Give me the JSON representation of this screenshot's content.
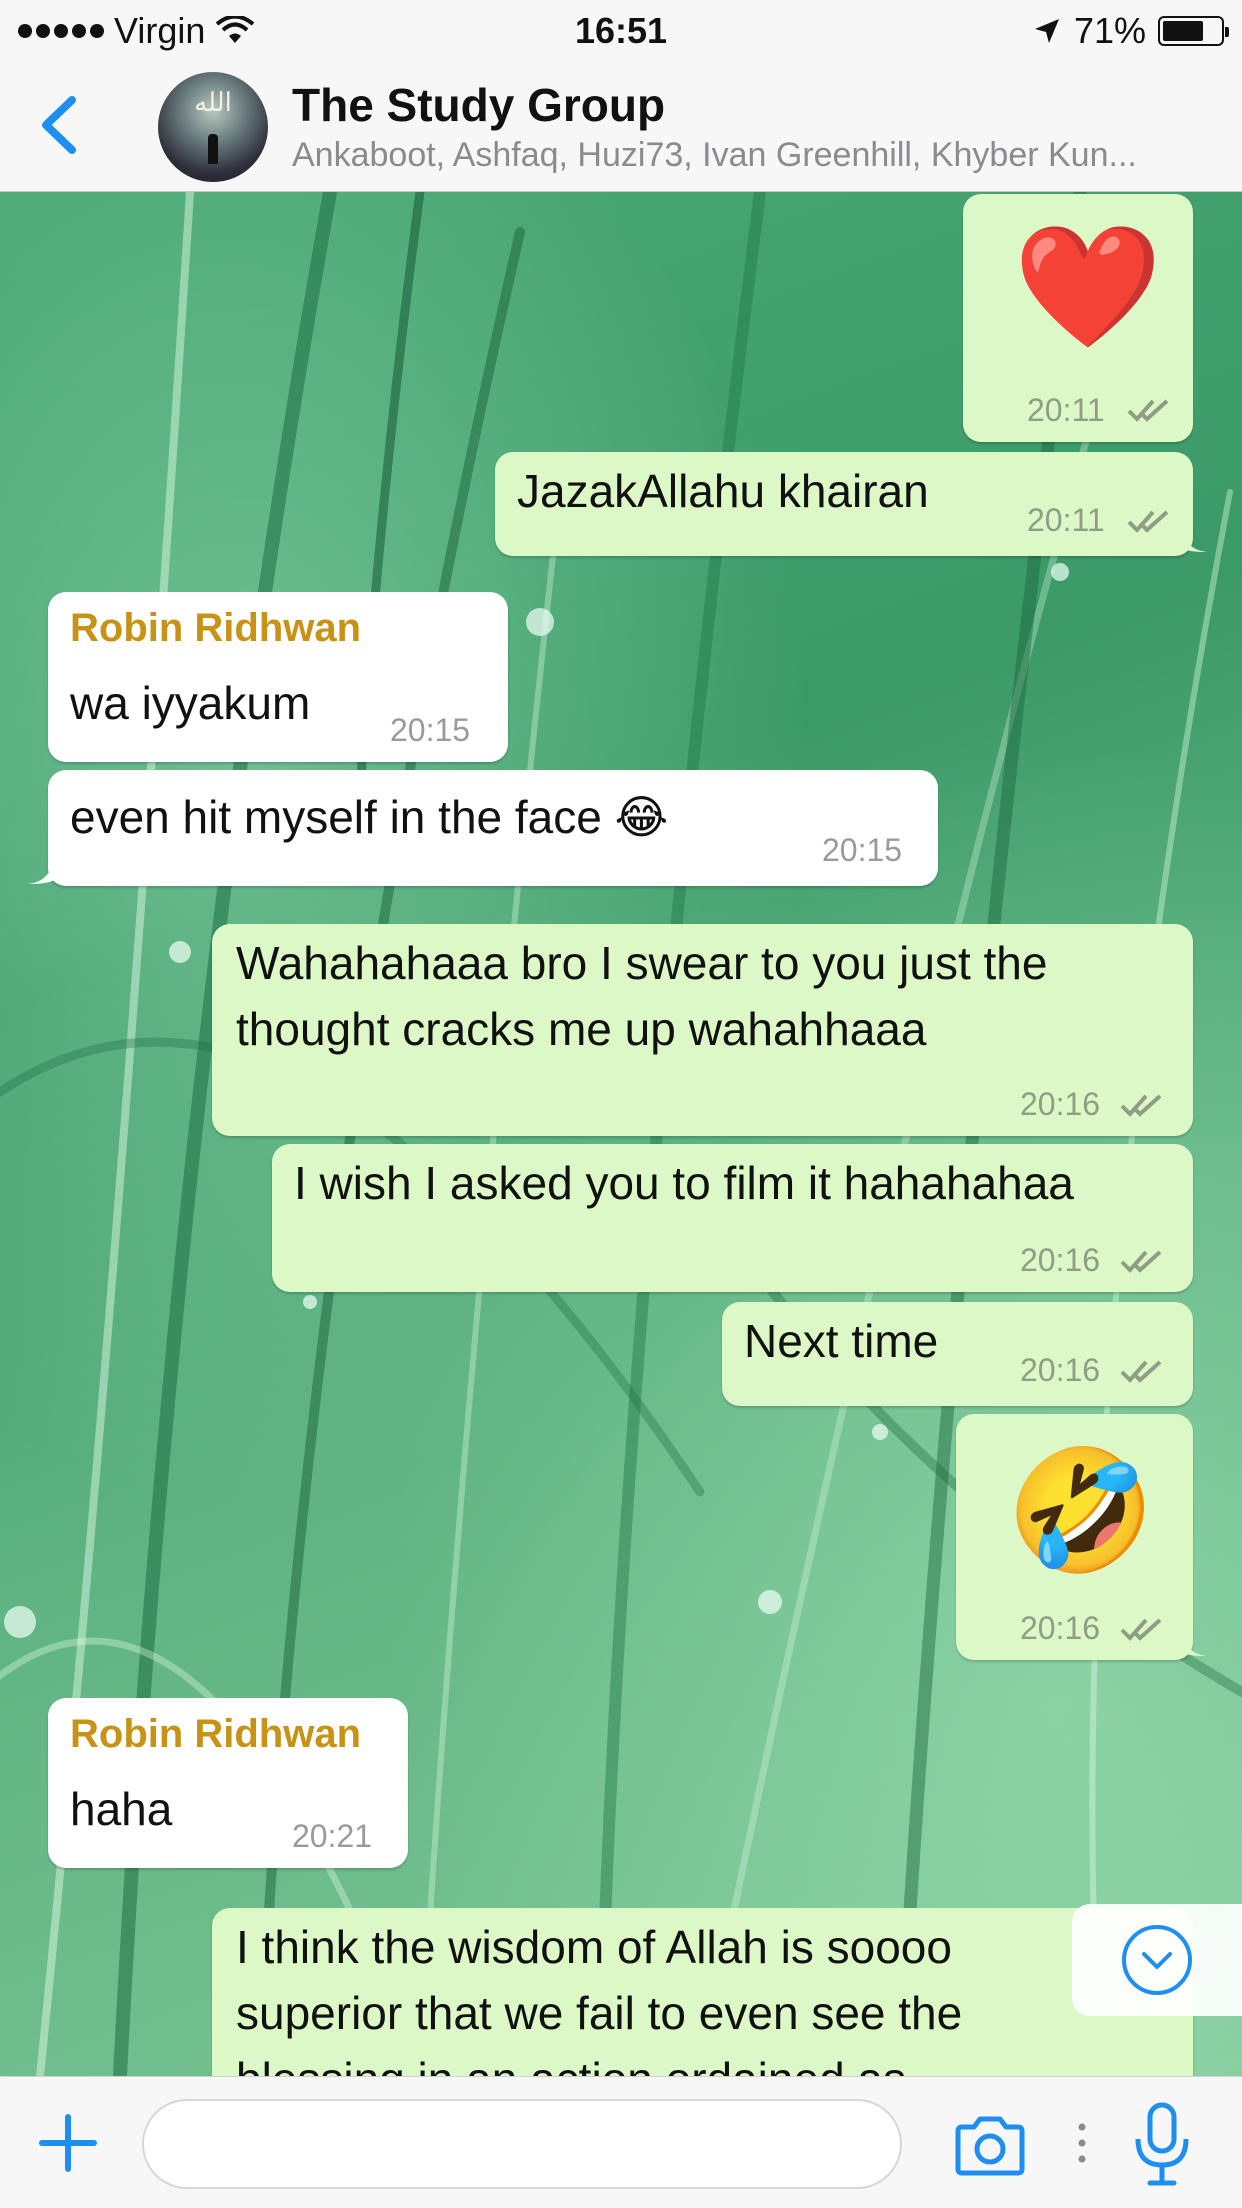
{
  "status_bar": {
    "carrier": "Virgin",
    "time": "16:51",
    "battery": "71%",
    "battery_level": 0.71
  },
  "header": {
    "title": "The Study Group",
    "subtitle": "Ankaboot, Ashfaq, Huzi73, Ivan Greenhill, Khyber Kun...",
    "back_icon": "chevron-left-icon",
    "avatar_glyph": "الله"
  },
  "messages": [
    {
      "id": "m1",
      "direction": "out",
      "emoji": "❤️",
      "time": "20:11",
      "status": "read"
    },
    {
      "id": "m2",
      "direction": "out",
      "text": "JazakAllahu khairan",
      "time": "20:11",
      "status": "read"
    },
    {
      "id": "m3",
      "direction": "in",
      "sender": "Robin Ridhwan",
      "text": "wa iyyakum",
      "time": "20:15"
    },
    {
      "id": "m4",
      "direction": "in",
      "text": "even hit myself in the face 😂",
      "time": "20:15"
    },
    {
      "id": "m5",
      "direction": "out",
      "lines": [
        "Wahahahaaa bro I swear to you just the",
        "thought cracks me up wahahhaaa"
      ],
      "time": "20:16",
      "status": "read"
    },
    {
      "id": "m6",
      "direction": "out",
      "text": "I wish I asked you to film it hahahahaa",
      "time": "20:16",
      "status": "read"
    },
    {
      "id": "m7",
      "direction": "out",
      "text": "Next time",
      "time": "20:16",
      "status": "read"
    },
    {
      "id": "m8",
      "direction": "out",
      "emoji": "🤣",
      "time": "20:16",
      "status": "read"
    },
    {
      "id": "m9",
      "direction": "in",
      "sender": "Robin Ridhwan",
      "text": "haha",
      "time": "20:21"
    },
    {
      "id": "m10",
      "direction": "out",
      "lines": [
        "I think the wisdom of Allah is soooo",
        "superior that we fail to even see the",
        "blessing in an action ordained as"
      ]
    }
  ],
  "input_bar": {
    "placeholder": "",
    "icons": [
      "plus-icon",
      "camera-icon",
      "microphone-icon"
    ]
  },
  "colors": {
    "accent": "#1f8ef1",
    "outgoing_bubble": "#dcf8c6",
    "incoming_bubble": "#ffffff",
    "sender_name": "#c79215"
  }
}
